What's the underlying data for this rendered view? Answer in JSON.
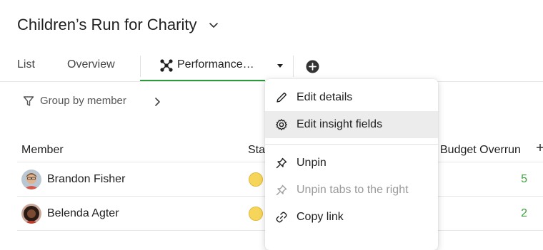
{
  "project": {
    "title": "Children’s Run for Charity"
  },
  "tabs": [
    {
      "label": "List"
    },
    {
      "label": "Overview"
    },
    {
      "label": "Performance…"
    }
  ],
  "toolbar": {
    "group_by_label": "Group by member"
  },
  "table": {
    "columns": [
      "Member",
      "Sta",
      "Budget Overrun"
    ],
    "rows": [
      {
        "name": "Brandon Fisher",
        "budget_overrun": "5"
      },
      {
        "name": "Belenda Agter",
        "budget_overrun": "2"
      }
    ]
  },
  "context_menu": {
    "items": [
      {
        "label": "Edit details",
        "icon": "pencil-icon"
      },
      {
        "label": "Edit insight fields",
        "icon": "gear-icon"
      },
      {
        "label": "Unpin",
        "icon": "pin-icon"
      },
      {
        "label": "Unpin tabs to the right",
        "icon": "pin-icon"
      },
      {
        "label": "Copy link",
        "icon": "link-icon"
      }
    ]
  },
  "colors": {
    "accent_green": "#2c9a3b",
    "value_green": "#3aa03a",
    "status_yellow": "#f6d65a"
  }
}
